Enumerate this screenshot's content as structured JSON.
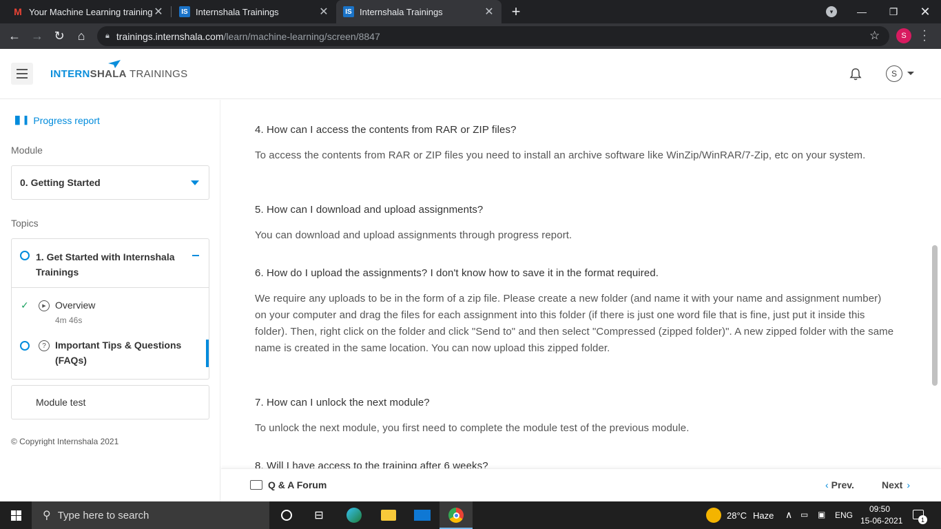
{
  "browser": {
    "tabs": [
      {
        "title": "Your Machine Learning training s",
        "favicon": "gmail-icon"
      },
      {
        "title": "Internshala Trainings",
        "favicon": "internshala-icon"
      },
      {
        "title": "Internshala Trainings",
        "favicon": "internshala-icon"
      }
    ],
    "favicon_is_text": "IS",
    "gmail_letter": "M",
    "url_host": "trainings.internshala.com",
    "url_path": "/learn/machine-learning/screen/8847",
    "profile_initial": "S"
  },
  "header": {
    "brand_part1": "INTERN",
    "brand_part2": "SHALA",
    "brand_part3": " TRAININGS",
    "user_initial": "S"
  },
  "sidebar": {
    "progress_report": "Progress report",
    "module_label": "Module",
    "module_selected": "0. Getting Started",
    "topics_label": "Topics",
    "topic_title": "1. Get Started with Internshala Trainings",
    "items": [
      {
        "title": "Overview",
        "meta": "4m 46s",
        "status": "completed"
      },
      {
        "title": "Important Tips & Questions (FAQs)",
        "status": "active"
      }
    ],
    "module_test": "Module test",
    "copyright": "© Copyright Internshala 2021"
  },
  "faqs": [
    {
      "q": "4. How can I access the contents from RAR or ZIP files?",
      "a": "To access the contents from RAR or ZIP files you need to install an archive software like WinZip/WinRAR/7-Zip, etc on your system."
    },
    {
      "q": "5. How can I download and upload assignments?",
      "a": "You can download and upload assignments through progress report."
    },
    {
      "q": "6. How do I upload the assignments? I don't know how to save it in the format required.",
      "a": "We require any uploads to be in the form of a zip file. Please create a new folder (and name it with your name and assignment number) on your computer and drag the files for each assignment into this folder (if there is just one word file that is fine, just put it inside this folder). Then, right click on the folder and click \"Send to\" and then select \"Compressed (zipped folder)\". A new zipped folder with the same name is created in the same location. You can now upload this zipped folder."
    },
    {
      "q": "7. How can I unlock the next module?",
      "a": "To unlock the next module, you first need to complete the module test of the previous module."
    },
    {
      "q": "8. Will I have access to the training after 6 weeks?",
      "a": ""
    }
  ],
  "footer": {
    "forum": "Q & A Forum",
    "prev": "Prev.",
    "next": "Next"
  },
  "taskbar": {
    "search_placeholder": "Type here to search",
    "temperature": "28°C",
    "weather": "Haze",
    "language": "ENG",
    "time": "09:50",
    "date": "15-06-2021",
    "notification_count": "1"
  },
  "colors": {
    "accent": "#008bdc",
    "check": "#1aa260",
    "chrome_dark": "#202124"
  }
}
